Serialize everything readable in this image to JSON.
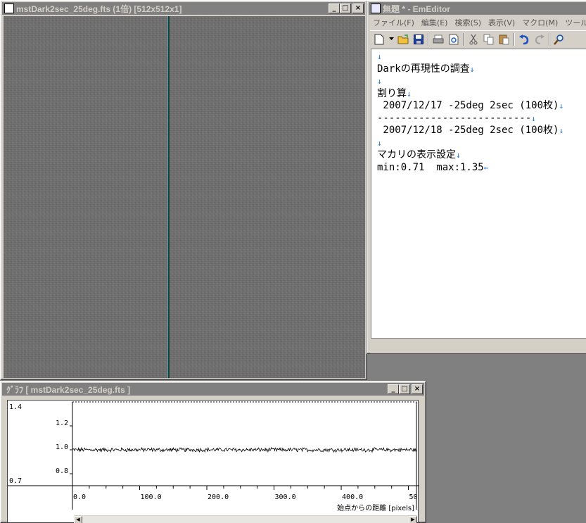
{
  "image_window": {
    "title": "mstDark2sec_25deg.fts (1倍) [512x512x1]",
    "buttons": {
      "minimize": "_",
      "maximize": "□",
      "close": "×"
    }
  },
  "editor_window": {
    "title": "無題 * - EmEditor",
    "menu": [
      "ファイル(F)",
      "編集(E)",
      "検索(S)",
      "表示(V)",
      "マクロ(M)",
      "ツール"
    ],
    "toolbar_icons": [
      "new-file-icon",
      "dropdown-arrow-icon",
      "open-folder-icon",
      "save-icon",
      "print-icon",
      "print-preview-icon",
      "cut-icon",
      "copy-icon",
      "paste-icon",
      "undo-icon",
      "redo-icon",
      "find-icon"
    ],
    "lines": [
      {
        "text": "",
        "mark": "↓"
      },
      {
        "text": "Darkの再現性の調査",
        "mark": "↓"
      },
      {
        "text": "",
        "mark": "↓"
      },
      {
        "text": "割り算",
        "mark": "↓"
      },
      {
        "text": " 2007/12/17 -25deg 2sec (100枚)",
        "mark": "↓"
      },
      {
        "text": "--------------------------",
        "mark": "↓"
      },
      {
        "text": " 2007/12/18 -25deg 2sec (100枚)",
        "mark": "↓"
      },
      {
        "text": "",
        "mark": "↓"
      },
      {
        "text": "マカリの表示設定",
        "mark": "↓"
      },
      {
        "text": "min:0.71  max:1.35",
        "mark": "←"
      }
    ]
  },
  "graph_window": {
    "title": "ｸﾞﾗﾌ [ mstDark2sec_25deg.fts ]",
    "buttons": {
      "minimize": "_",
      "maximize": "□",
      "close": "×"
    }
  },
  "chart_data": {
    "type": "line",
    "xlabel": "始点からの距離 [pixels]",
    "ylabel": "",
    "title": "",
    "xlim": [
      0,
      512
    ],
    "ylim": [
      0.7,
      1.4
    ],
    "y_left_labels": [
      "1.4",
      "0.7"
    ],
    "y_ticks": [
      "1.2",
      "1.0",
      "0.8"
    ],
    "x_ticks": [
      "0.0",
      "100.0",
      "200.0",
      "300.0",
      "400.0",
      "50"
    ],
    "series": [
      {
        "name": "",
        "mean": 1.0,
        "noise_amplitude": 0.015
      }
    ]
  },
  "colors": {
    "titlebar_inactive": "#808080",
    "titlebar_active": "#0a246a",
    "image_gray": "#6f6f6f",
    "newline_mark": "#1a6fd0"
  }
}
